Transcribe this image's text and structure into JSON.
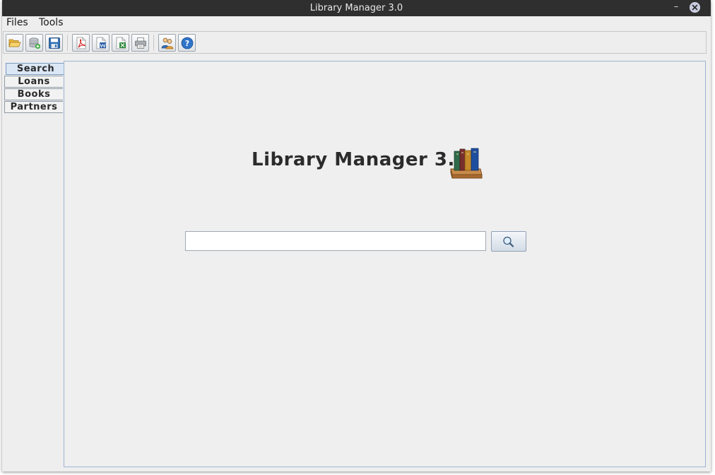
{
  "window": {
    "title": "Library Manager 3.0",
    "minimize_glyph": "–"
  },
  "menu": [
    {
      "label": "Files"
    },
    {
      "label": "Tools"
    }
  ],
  "toolbar": {
    "buttons": [
      {
        "icon": "open-folder-icon"
      },
      {
        "icon": "new-database-icon"
      },
      {
        "icon": "save-icon"
      },
      {
        "icon": "export-pdf-icon"
      },
      {
        "icon": "export-word-icon"
      },
      {
        "icon": "export-excel-icon"
      },
      {
        "icon": "print-icon"
      },
      {
        "icon": "users-icon"
      },
      {
        "icon": "help-icon"
      }
    ]
  },
  "tabs": [
    {
      "label": "Search",
      "active": true
    },
    {
      "label": "Loans",
      "active": false
    },
    {
      "label": "Books",
      "active": false
    },
    {
      "label": "Partners",
      "active": false
    }
  ],
  "main": {
    "heading": "Library Manager 3.0",
    "search_value": "",
    "search_button_icon": "magnifier-icon"
  },
  "colors": {
    "titlebar": "#2f2f2f",
    "window_bg": "#eeeeee",
    "active_tab": "#dbe7f5",
    "panel_border": "#9db4d3"
  }
}
